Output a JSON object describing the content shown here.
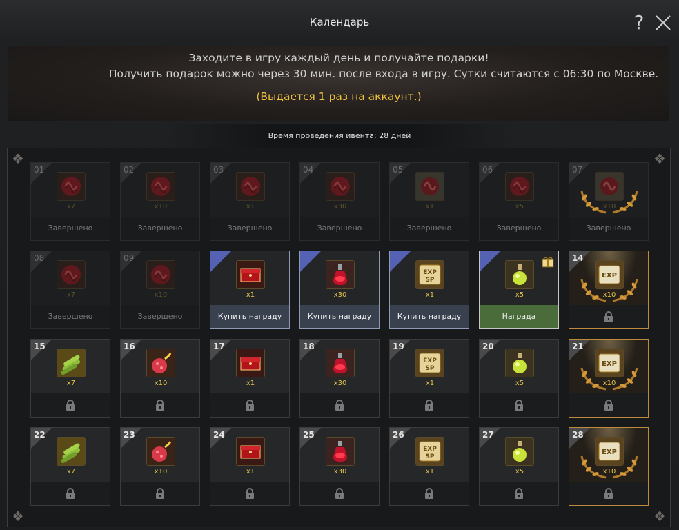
{
  "window": {
    "title": "Календарь"
  },
  "banner": {
    "line1": "Заходите в игру каждый день и получайте подарки!",
    "line2": "Получить подарок можно через 30 мин. после входа в игру. Сутки считаются с 06:30 по Москве.",
    "line3": "(Выдается 1 раз на аккаунт.)"
  },
  "event_time": "Время проведения ивента: 28 дней",
  "labels": {
    "completed": "Завершено",
    "buy": "Купить награду",
    "claim": "Награда"
  },
  "colors": {
    "accent_gold": "#f0c23c",
    "buy_blue": "#5562b4",
    "claim_green": "#4a6b3a",
    "special_border": "#c08a3e"
  },
  "days": [
    {
      "num": "01",
      "item": "red-swirl-icon",
      "qty": "x7",
      "state": "done"
    },
    {
      "num": "02",
      "item": "red-swirl-icon",
      "qty": "x10",
      "state": "done"
    },
    {
      "num": "03",
      "item": "red-swirl-icon",
      "qty": "x1",
      "state": "done"
    },
    {
      "num": "04",
      "item": "red-swirl-icon",
      "qty": "x30",
      "state": "done"
    },
    {
      "num": "05",
      "item": "red-swirl-stone-icon",
      "qty": "x1",
      "state": "done"
    },
    {
      "num": "06",
      "item": "red-swirl-icon",
      "qty": "x5",
      "state": "done"
    },
    {
      "num": "07",
      "item": "red-swirl-stone-icon",
      "qty": "x10",
      "state": "done",
      "special": true
    },
    {
      "num": "08",
      "item": "red-swirl-icon",
      "qty": "x7",
      "state": "done"
    },
    {
      "num": "09",
      "item": "red-swirl-icon",
      "qty": "x10",
      "state": "done"
    },
    {
      "num": "",
      "item": "red-chest-icon",
      "qty": "x1",
      "state": "buy"
    },
    {
      "num": "",
      "item": "red-potion-icon",
      "qty": "x30",
      "state": "buy"
    },
    {
      "num": "",
      "item": "exp-sp-scroll-icon",
      "qty": "x1",
      "state": "buy"
    },
    {
      "num": "",
      "item": "yellow-potion-icon",
      "qty": "x5",
      "state": "claim"
    },
    {
      "num": "14",
      "item": "exp-scroll-icon",
      "qty": "x10",
      "state": "locked",
      "special": true
    },
    {
      "num": "15",
      "item": "bamboo-icon",
      "qty": "x7",
      "state": "locked"
    },
    {
      "num": "16",
      "item": "red-fruit-icon",
      "qty": "x10",
      "state": "locked"
    },
    {
      "num": "17",
      "item": "red-chest-icon",
      "qty": "x1",
      "state": "locked"
    },
    {
      "num": "18",
      "item": "red-potion-icon",
      "qty": "x30",
      "state": "locked"
    },
    {
      "num": "19",
      "item": "exp-sp-scroll-icon",
      "qty": "x1",
      "state": "locked"
    },
    {
      "num": "20",
      "item": "yellow-potion-icon",
      "qty": "x5",
      "state": "locked"
    },
    {
      "num": "21",
      "item": "exp-scroll-icon",
      "qty": "x10",
      "state": "locked",
      "special": true
    },
    {
      "num": "22",
      "item": "bamboo-icon",
      "qty": "x7",
      "state": "locked"
    },
    {
      "num": "23",
      "item": "red-fruit-icon",
      "qty": "x10",
      "state": "locked"
    },
    {
      "num": "24",
      "item": "red-chest-icon",
      "qty": "x1",
      "state": "locked"
    },
    {
      "num": "25",
      "item": "red-potion-icon",
      "qty": "x30",
      "state": "locked"
    },
    {
      "num": "26",
      "item": "exp-sp-scroll-icon",
      "qty": "x1",
      "state": "locked"
    },
    {
      "num": "27",
      "item": "yellow-potion-icon",
      "qty": "x5",
      "state": "locked"
    },
    {
      "num": "28",
      "item": "exp-scroll-icon",
      "qty": "x10",
      "state": "locked",
      "special": true
    }
  ]
}
